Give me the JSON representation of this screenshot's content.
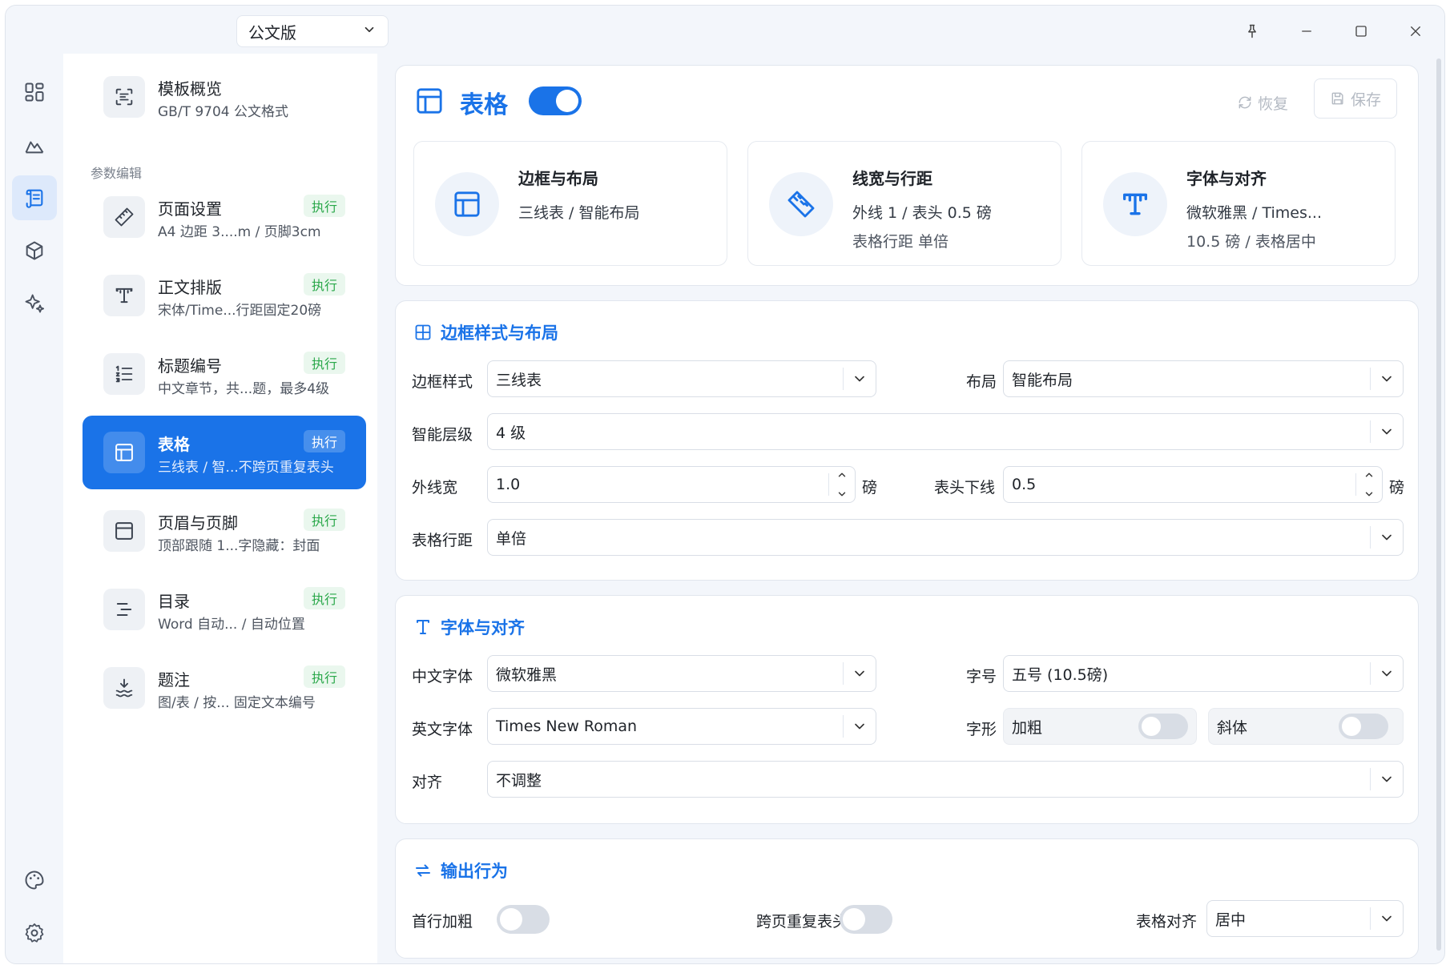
{
  "titlebar": {
    "template_select": "公文版"
  },
  "nav": {
    "section_label": "参数编辑",
    "overview": {
      "title": "模板概览",
      "sub": "GB/T 9704 公文格式"
    },
    "items": [
      {
        "title": "页面设置",
        "sub": "A4  边距 3....m / 页脚3cm",
        "badge": "执行"
      },
      {
        "title": "正文排版",
        "sub": "宋体/Time...行距固定20磅",
        "badge": "执行"
      },
      {
        "title": "标题编号",
        "sub": "中文章节，共...题，最多4级",
        "badge": "执行"
      },
      {
        "title": "表格",
        "sub": "三线表 / 智...不跨页重复表头",
        "badge": "执行"
      },
      {
        "title": "页眉与页脚",
        "sub": "顶部跟随 1...字隐藏：封面",
        "badge": "执行"
      },
      {
        "title": "目录",
        "sub": "Word 自动... / 自动位置",
        "badge": "执行"
      },
      {
        "title": "题注",
        "sub": "图/表 / 按... 固定文本编号",
        "badge": "执行"
      }
    ]
  },
  "header": {
    "title": "表格",
    "enabled": true,
    "restore_label": "恢复",
    "save_label": "保存"
  },
  "summary": [
    {
      "title": "边框与布局",
      "line1": "三线表 / 智能布局",
      "line2": ""
    },
    {
      "title": "线宽与行距",
      "line1": "外线 1 / 表头 0.5 磅",
      "line2": "表格行距 单倍"
    },
    {
      "title": "字体与对齐",
      "line1": "微软雅黑 / Times...",
      "line2": "10.5 磅 / 表格居中"
    }
  ],
  "border_section": {
    "title": "边框样式与布局",
    "border_style_label": "边框样式",
    "border_style_value": "三线表",
    "layout_label": "布局",
    "layout_value": "智能布局",
    "level_label": "智能层级",
    "level_value": "4 级",
    "outer_width_label": "外线宽",
    "outer_width_value": "1.0",
    "header_line_label": "表头下线",
    "header_line_value": "0.5",
    "unit": "磅",
    "row_spacing_label": "表格行距",
    "row_spacing_value": "单倍"
  },
  "font_section": {
    "title": "字体与对齐",
    "cn_font_label": "中文字体",
    "cn_font_value": "微软雅黑",
    "size_label": "字号",
    "size_value": "五号 (10.5磅)",
    "en_font_label": "英文字体",
    "en_font_value": "Times New Roman",
    "style_label": "字形",
    "bold_label": "加粗",
    "bold_on": false,
    "italic_label": "斜体",
    "italic_on": false,
    "align_label": "对齐",
    "align_value": "不调整"
  },
  "output_section": {
    "title": "输出行为",
    "first_row_bold_label": "首行加粗",
    "first_row_bold_on": false,
    "repeat_header_label": "跨页重复表头",
    "repeat_header_on": false,
    "table_align_label": "表格对齐",
    "table_align_value": "居中"
  },
  "colors": {
    "accent": "#1a73e8",
    "badge_green": "#2aa84a",
    "background": "#f3f6fb"
  }
}
